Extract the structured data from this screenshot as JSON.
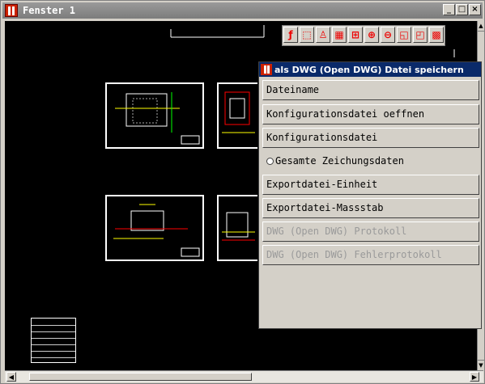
{
  "window": {
    "title": "Fenster 1",
    "minimize_label": "_",
    "maximize_label": "□",
    "close_label": "×"
  },
  "toolbar": {
    "icons": [
      "fire-icon",
      "select-icon",
      "figure-icon",
      "grid-icon",
      "fit-icon",
      "zoom-in-icon",
      "zoom-out-icon",
      "zoom-window-icon",
      "window-icon",
      "hatch-icon"
    ]
  },
  "dialog": {
    "title": "als DWG (Open DWG) Datei speichern",
    "buttons": {
      "dateiname": "Dateiname",
      "konfig_oeffnen": "Konfigurationsdatei oeffnen",
      "konfig": "Konfigurationsdatei",
      "gesamte": "Gesamte Zeichungsdaten",
      "einheit": "Exportdatei-Einheit",
      "massstab": "Exportdatei-Massstab",
      "protokoll": "DWG (Open DWG)  Protokoll",
      "fehlerprotokoll": "DWG (Open DWG)  Fehlerprotokoll"
    }
  },
  "colors": {
    "canvas": "#000000",
    "dialog_title": "#0a2a6a",
    "icon_red": "#cc2200"
  }
}
